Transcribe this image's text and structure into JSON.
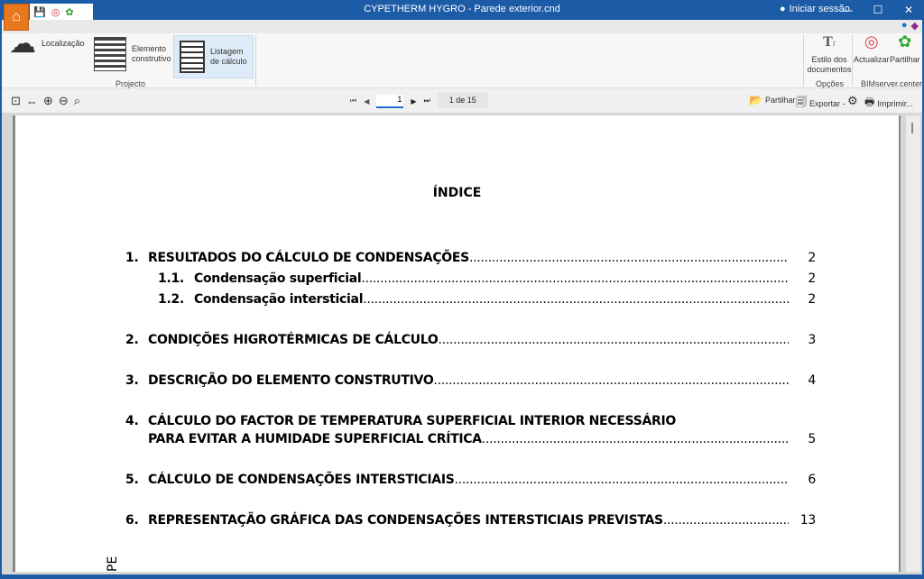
{
  "window": {
    "title": "CYPETHERM HYGRO - Parede exterior.cnd",
    "login": "Iniciar sessão"
  },
  "ribbon": {
    "localizacao": "Localização",
    "elemento": [
      "Elemento",
      "construtivo"
    ],
    "listagem": [
      "Listagem",
      "de cálculo"
    ],
    "group_projecto": "Projecto",
    "estilo": [
      "Estilo dos",
      "documentos"
    ],
    "group_opcoes": "Opções",
    "actualizar": "Actualizar",
    "partilhar": "Partilhar",
    "group_bim": "BIMserver.center"
  },
  "toolbar": {
    "page_input": "1",
    "page_count": "1 de 15",
    "partilhar": "Partilhar",
    "exportar": "Exportar -",
    "imprimir": "Imprimir..."
  },
  "document": {
    "heading": "ÍNDICE",
    "entries": [
      {
        "num": "1.",
        "text": "RESULTADOS DO CÁLCULO DE CONDENSAÇÕES",
        "page": "2"
      },
      {
        "num": "1.1.",
        "text": "Condensação superficial",
        "page": "2"
      },
      {
        "num": "1.2.",
        "text": "Condensação intersticial",
        "page": "2"
      },
      {
        "num": "2.",
        "text": "CONDIÇÕES HIGROTÉRMICAS DE CÁLCULO",
        "page": "3"
      },
      {
        "num": "3.",
        "text": "DESCRIÇÃO DO ELEMENTO CONSTRUTIVO",
        "page": "4"
      },
      {
        "num": "4.",
        "text": "CÁLCULO DO FACTOR DE TEMPERATURA SUPERFICIAL INTERIOR NECESSÁRIO",
        "text2": "PARA EVITAR A HUMIDADE SUPERFICIAL CRÍTICA",
        "page": "5"
      },
      {
        "num": "5.",
        "text": "CÁLCULO DE CONDENSAÇÕES INTERSTICIAIS",
        "page": "6"
      },
      {
        "num": "6.",
        "text": "REPRESENTAÇÃO GRÁFICA DAS CONDENSAÇÕES INTERSTICIAIS PREVISTAS",
        "page": "13"
      }
    ],
    "side_text": "PE"
  }
}
